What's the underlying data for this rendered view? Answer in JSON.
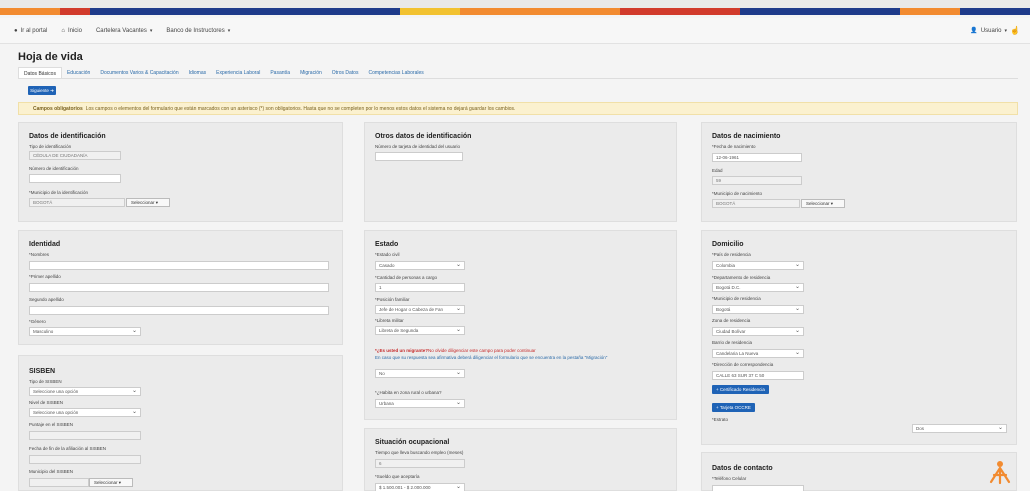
{
  "colors": {
    "primary": "#1f63b6",
    "stripe": [
      "#f28b30",
      "#d13a2c",
      "#1e3a8a",
      "#f2c230",
      "#f28b30",
      "#d13a2c",
      "#1e3a8a",
      "#f28b30",
      "#1e3a8a"
    ]
  },
  "topnav": {
    "portal": "Ir al portal",
    "inicio": "Inicio",
    "cartelera": "Cartelera Vacantes",
    "banco": "Banco de Instructores",
    "user": "Usuario"
  },
  "page_title": "Hoja de vida",
  "tabs": [
    "Datos Básicos",
    "Educación",
    "Documentos Varios & Capacitación",
    "Idiomas",
    "Experiencia Laboral",
    "Pasantía",
    "Migración",
    "Otros Datos",
    "Competencias Laborales"
  ],
  "next_button": "Siguiente",
  "alert": {
    "bold": "Campos obligatorios",
    "text": "Los campos o elementos del formulario que están marcados con un asterisco (*) son obligatorios. Hasta que no se completen por lo menos estos datos el sistema no dejará guardar los cambios."
  },
  "identificacion": {
    "title": "Datos de identificación",
    "tipo_label": "Tipo de identificación",
    "tipo_value": "CÉDULA DE CIUDADANÍA",
    "numero_label": "Número de identificación",
    "municipio_label": "*Municipio de la identificación",
    "municipio_value": "BOGOTÁ",
    "select_label": "Seleccionar"
  },
  "otros_ident": {
    "title": "Otros datos de identificación",
    "tarjeta_label": "Número de tarjeta de identidad del usuario"
  },
  "nacimiento": {
    "title": "Datos de nacimiento",
    "fecha_label": "*Fecha de nacimiento",
    "fecha_value": "12-06-1961",
    "edad_label": "Edad",
    "edad_value": "59",
    "municipio_label": "*Municipio de nacimiento",
    "municipio_value": "BOGOTÁ",
    "select_label": "Seleccionar"
  },
  "identidad": {
    "title": "Identidad",
    "nombres_label": "*Nombres",
    "primer_apellido_label": "*Primer apellido",
    "segundo_apellido_label": "Segundo apellido",
    "genero_label": "*Género",
    "genero_value": "Masculino"
  },
  "estado": {
    "title": "Estado",
    "civil_label": "*Estado civil",
    "civil_value": "Casado",
    "personas_label": "*Cantidad de personas a cargo",
    "personas_value": "1",
    "posicion_label": "*Posición familiar",
    "posicion_value": "Jefe de Hogar o Cabeza de Fan",
    "libreta_label": "*Libreta militar",
    "libreta_value": "Libreta de Segunda",
    "migrante_q": "*¿Es usted un migrante?",
    "migrante_note": "No olvide diligenciar este campo para poder continuar",
    "migrante_help": "En caso que su respuesta sea afirmativa deberá diligenciar el formulario que se encuentra en la pestaña \"Migración\"",
    "migrante_value": "No",
    "zona_label": "*¿Habita en zona rural o urbana?",
    "zona_value": "Urbana"
  },
  "domicilio": {
    "title": "Domicilio",
    "pais_label": "*País de residencia",
    "pais_value": "Colombia",
    "depto_label": "*Departamento de residencia",
    "depto_value": "Bogotá D.C.",
    "municipio_label": "*Municipio de residencia",
    "municipio_value": "Bogotá",
    "zona_label": "Zona de residencia",
    "zona_value": "Ciudad Bolívar",
    "barrio_label": "Barrio de residencia",
    "barrio_value": "Candelaria La Nueva",
    "direccion_label": "*Dirección de correspondencia",
    "direccion_value": "CALLE 63 SUR 37 C 50",
    "cert_button": "Certificado Residencia",
    "ocore_button": "Tarjeta OCCRE",
    "estrato_label": "*Estrato",
    "estrato_value": "Dos"
  },
  "sisben": {
    "title": "SISBEN",
    "tipo_label": "Tipo de SISBEN",
    "tipo_value": "Seleccione una opción",
    "nivel_label": "Nivel de SISBEN",
    "nivel_value": "Seleccione una opción",
    "puntaje_label": "Puntaje en el SISBEN",
    "fecha_label": "Fecha de fin de la afiliación al SISBEN",
    "municipio_label": "Municipio del SISBEN",
    "select_label": "Seleccionar"
  },
  "ocupacional": {
    "title": "Situación ocupacional",
    "tiempo_label": "Tiempo que lleva buscando empleo (meses)",
    "tiempo_value": "6",
    "sueldo_label": "*Sueldo que aceptaría",
    "sueldo_value": "$ 1.500.001 - $ 2.000.000"
  },
  "contacto": {
    "title": "Datos de contacto",
    "celular_label": "*Teléfono Celular"
  }
}
